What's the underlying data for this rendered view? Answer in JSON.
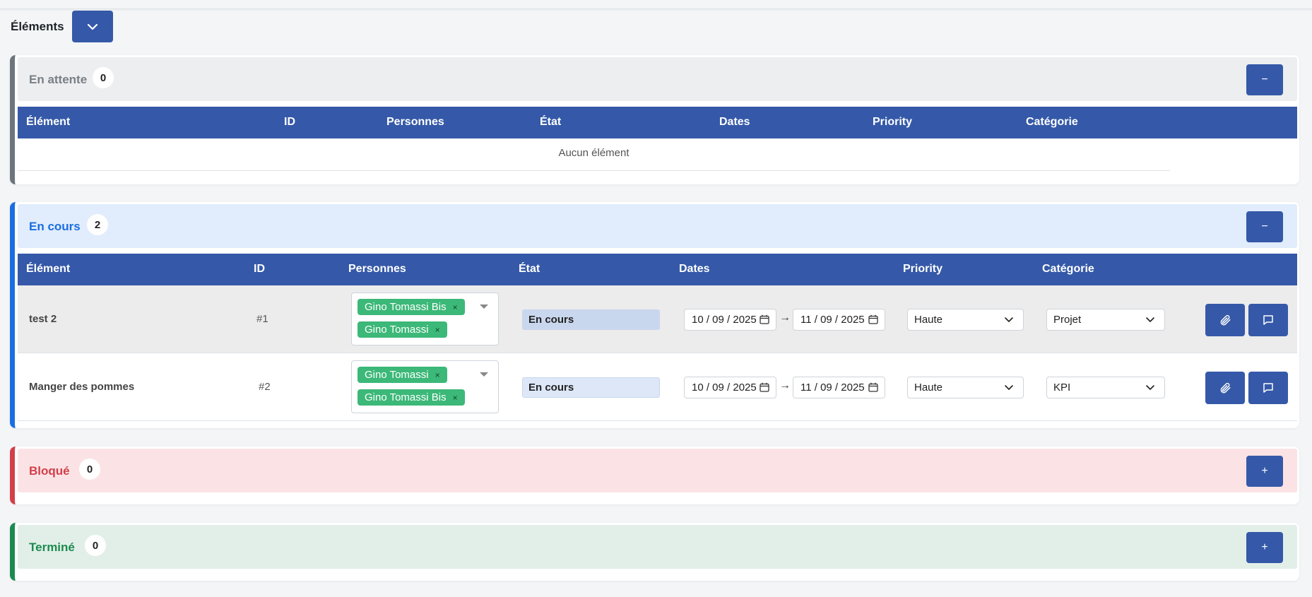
{
  "page": {
    "title": "Éléments"
  },
  "columns": [
    "Élément",
    "ID",
    "Personnes",
    "État",
    "Dates",
    "Priority",
    "Catégorie"
  ],
  "groups": {
    "pending": {
      "title": "En attente",
      "count": "0",
      "toggle": "−",
      "empty": "Aucun élément",
      "color": "#6c757d"
    },
    "progress": {
      "title": "En cours",
      "count": "2",
      "toggle": "−",
      "color": "#1a6ee0"
    },
    "blocked": {
      "title": "Bloqué",
      "count": "0",
      "toggle": "+",
      "color": "#d13f49"
    },
    "done": {
      "title": "Terminé",
      "count": "0",
      "toggle": "+",
      "color": "#1c8a4f"
    }
  },
  "rows": [
    {
      "name": "test 2",
      "id": "#1",
      "persons": [
        {
          "name": "Gino Tomassi Bis",
          "remove": "×"
        },
        {
          "name": "Gino Tomassi",
          "remove": "×"
        }
      ],
      "state": "En cours",
      "start": "10 / 09 / 2025",
      "end": "11 / 09 / 2025",
      "arrow": "→",
      "priority": "Haute",
      "category": "Projet"
    },
    {
      "name": "Manger des pommes",
      "id": "#2",
      "persons": [
        {
          "name": "Gino Tomassi",
          "remove": "×"
        },
        {
          "name": "Gino Tomassi Bis",
          "remove": "×"
        }
      ],
      "state": "En cours",
      "start": "10 / 09 / 2025",
      "end": "11 / 09 / 2025",
      "arrow": "→",
      "priority": "Haute",
      "category": "KPI"
    }
  ],
  "icons": {
    "toggle_all": "chevron-down-icon",
    "attach": "paperclip-icon",
    "comment": "comment-icon",
    "calendar": "calendar-icon",
    "select": "chevron-down-icon"
  }
}
